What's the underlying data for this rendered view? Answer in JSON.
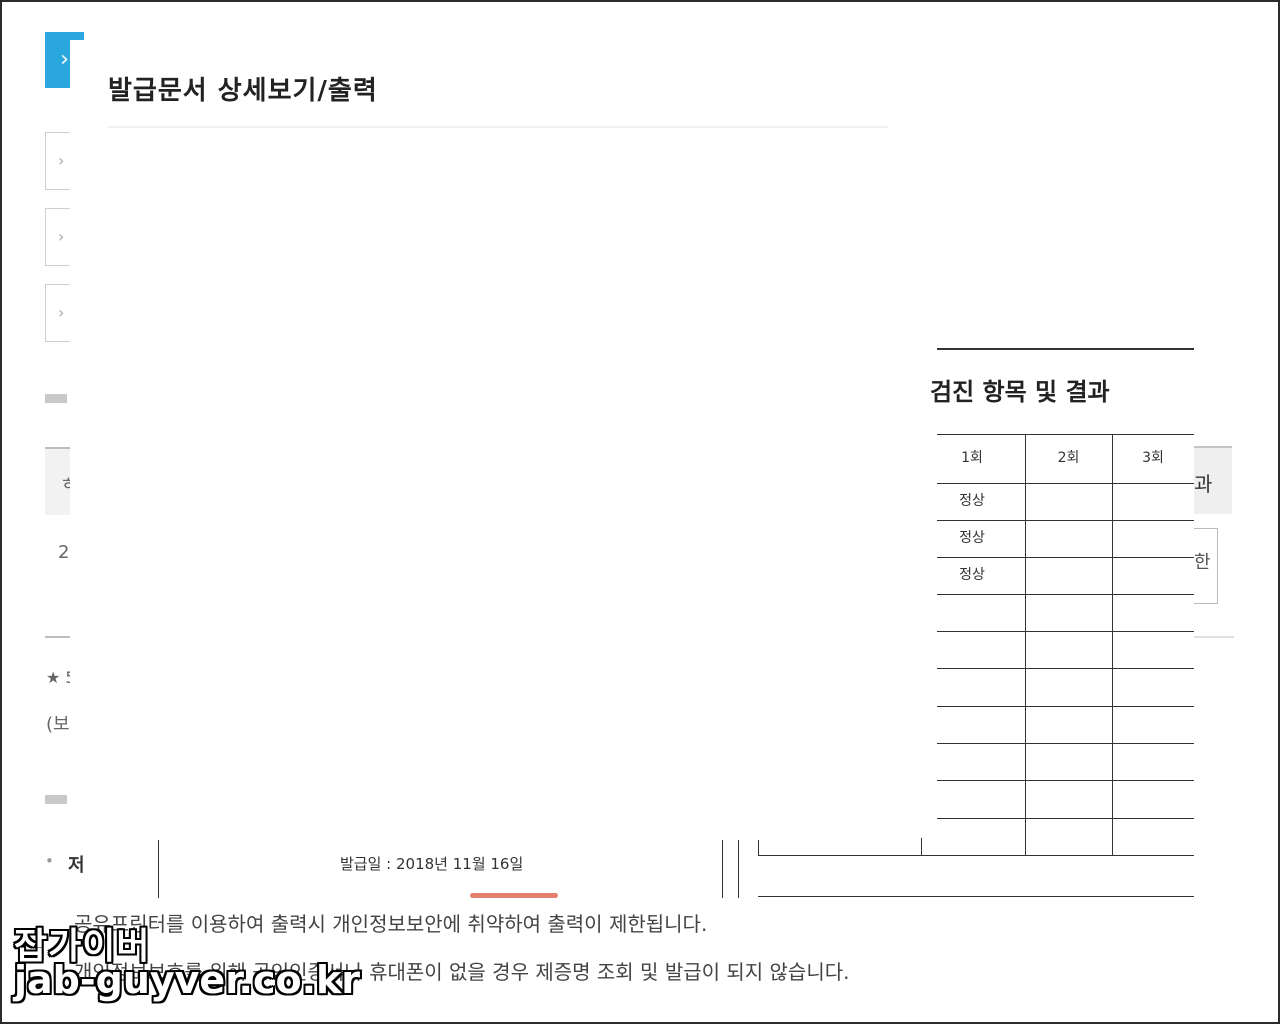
{
  "background": {
    "side_chevron": "›",
    "side_box_glyph": "›",
    "fragment_1": "ㅎ",
    "fragment_2": "2",
    "fragment_3": "★ 5",
    "fragment_4": "(보",
    "right_frag_1": "과",
    "right_frag_2": "한",
    "bullet": "•",
    "bullet_text": "저"
  },
  "modal": {
    "title": "발급문서 상세보기/출력"
  },
  "document": {
    "section_title": "검진 항목 및 결과",
    "table": {
      "headers": [
        "1회",
        "2회",
        "3회"
      ],
      "rows": [
        [
          "정상",
          "",
          ""
        ],
        [
          "정상",
          "",
          ""
        ],
        [
          "정상",
          "",
          ""
        ]
      ]
    },
    "issue_date": "발급일 :  2018년  11월  16일"
  },
  "notices": [
    "공유프린터를 이용하여 출력시 개인정보보안에 취약하여 출력이 제한됩니다.",
    "개인정보보호를 위해 공인인증서나 휴대폰이 없을 경우 제증명 조회 및 발급이 되지 않습니다."
  ],
  "watermark": {
    "line1": "잡가이버",
    "line2": "jab-guyver.co.kr"
  },
  "colors": {
    "accent": "#2aa7df",
    "highlight": "#e06a55"
  }
}
